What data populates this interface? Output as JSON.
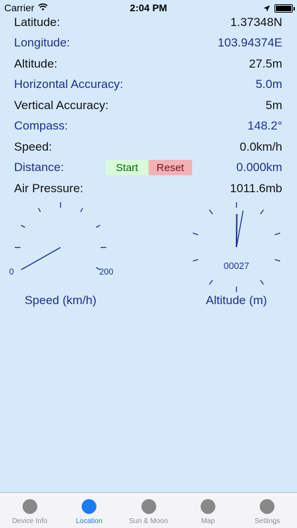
{
  "status": {
    "carrier": "Carrier",
    "time": "2:04 PM"
  },
  "rows": [
    {
      "label": "Latitude:",
      "value": "1.37348N"
    },
    {
      "label": "Longitude:",
      "value": "103.94374E"
    },
    {
      "label": "Altitude:",
      "value": "27.5m"
    },
    {
      "label": "Horizontal Accuracy:",
      "value": "5.0m"
    },
    {
      "label": "Vertical Accuracy:",
      "value": "5m"
    },
    {
      "label": "Compass:",
      "value": "148.2°"
    },
    {
      "label": "Speed:",
      "value": "0.0km/h"
    },
    {
      "label": "Distance:",
      "value": "0.000km"
    },
    {
      "label": "Air Pressure:",
      "value": "1011.6mb"
    }
  ],
  "distance_buttons": {
    "start": "Start",
    "reset": "Reset"
  },
  "speed_gauge": {
    "min_label": "0",
    "max_label": "200",
    "label": "Speed (km/h)",
    "value": 0
  },
  "altitude_gauge": {
    "counter": "00027",
    "label": "Altitude (m)"
  },
  "tabs": [
    {
      "label": "Device Info",
      "active": false
    },
    {
      "label": "Location",
      "active": true
    },
    {
      "label": "Sun & Moon",
      "active": false
    },
    {
      "label": "Map",
      "active": false
    },
    {
      "label": "Settings",
      "active": false
    }
  ],
  "colors": {
    "background": "#d6e9fb",
    "blue_text": "#1e2f8c",
    "active_tab": "#1a7cf0",
    "start_bg": "#d9fad8",
    "reset_bg": "#f3b3b6"
  }
}
